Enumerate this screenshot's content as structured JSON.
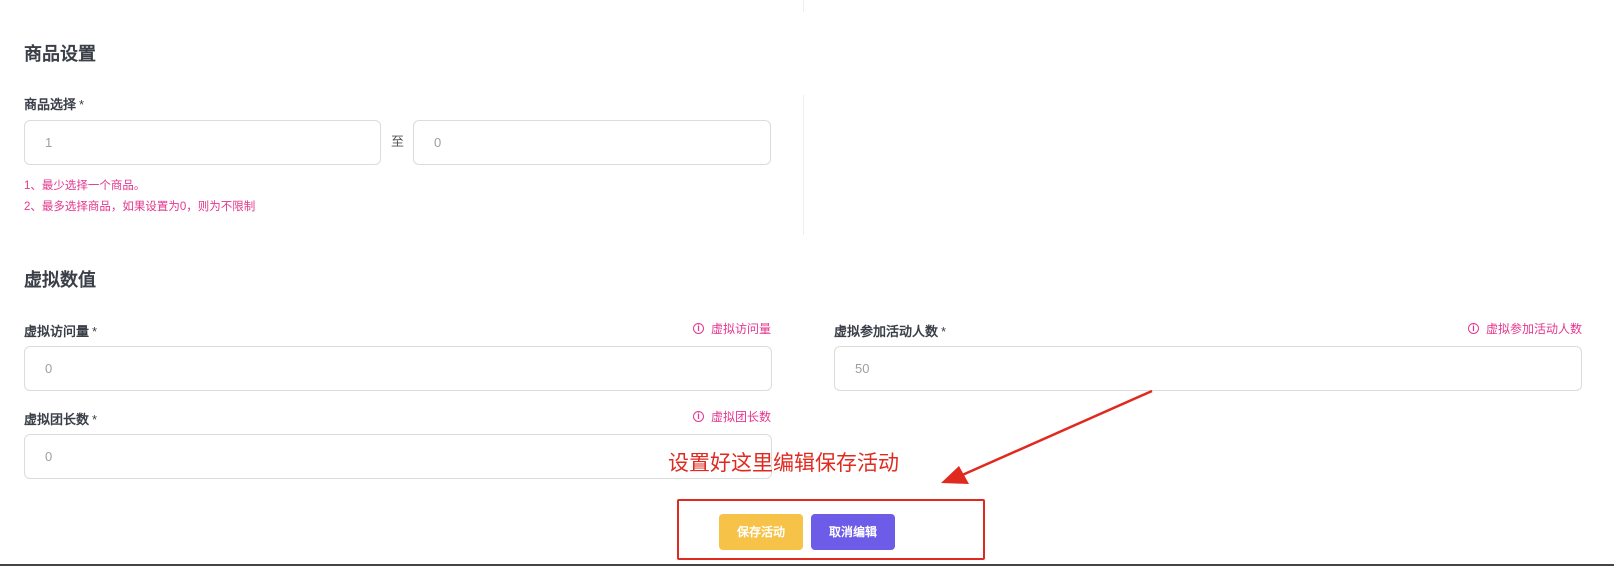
{
  "sections": {
    "goods": {
      "title": "商品设置",
      "field_label": "商品选择",
      "required_mark": "*",
      "min_placeholder": "1",
      "separator": "至",
      "max_placeholder": "0",
      "hints": [
        "1、最少选择一个商品。",
        "2、最多选择商品，如果设置为0，则为不限制"
      ]
    },
    "virtual": {
      "title": "虚拟数值",
      "required_mark": "*",
      "visits": {
        "label": "虚拟访问量",
        "help": "虚拟访问量",
        "placeholder": "0"
      },
      "participants": {
        "label": "虚拟参加活动人数",
        "help": "虚拟参加活动人数",
        "placeholder": "50"
      },
      "leaders": {
        "label": "虚拟团长数",
        "help": "虚拟团长数",
        "placeholder": "0"
      }
    }
  },
  "actions": {
    "save_label": "保存活动",
    "cancel_label": "取消编辑"
  },
  "annotation": {
    "text": "设置好这里编辑保存活动"
  },
  "icons": {
    "help": "info-circle-icon",
    "arrow": "annotation-arrow-icon"
  },
  "colors": {
    "accent_hint": "#e5368e",
    "save_button": "#f7c248",
    "cancel_button": "#6c5ce7",
    "annotation": "#e02a20"
  }
}
